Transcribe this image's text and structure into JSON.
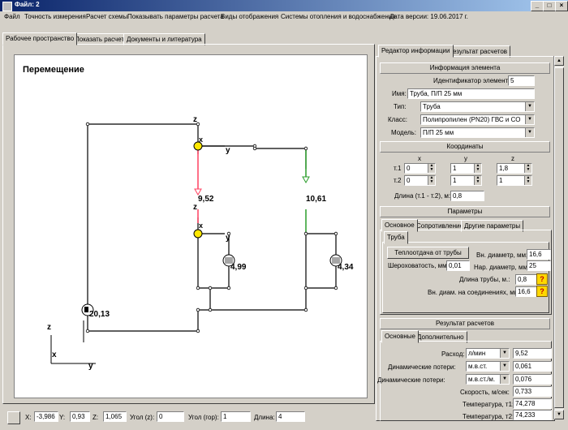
{
  "window": {
    "title": "Файл: 2"
  },
  "menu": [
    "Файл",
    "Точность измерения",
    "Расчет схемы",
    "Показывать параметры расчета",
    "Виды отображения",
    "Системы отопления и водоснабжения",
    "Дата версии: 19.06.2017 г."
  ],
  "main_tabs": [
    "Рабочее пространство",
    "Показать расчет",
    "Документы и литература"
  ],
  "canvas": {
    "title": "Перемещение",
    "axis_z": "z",
    "axis_x": "x",
    "axis_y": "y",
    "labels": {
      "l1": "9,52",
      "l2": "10,61",
      "l3": "4,99",
      "l4": "4,34",
      "l5": "20,13"
    }
  },
  "right_tabs": [
    "Редактор информации",
    "Результат расчетов"
  ],
  "info": {
    "header": "Информация элемента",
    "id_label": "Идентификатор элемента:",
    "id_value": "5",
    "name_label": "Имя:",
    "name_value": "Труба, П/П 25 мм",
    "type_label": "Тип:",
    "type_value": "Труба",
    "class_label": "Класс:",
    "class_value": "Полипропилен (PN20) ГВС и СО",
    "model_label": "Модель:",
    "model_value": "П/П 25 мм"
  },
  "coords": {
    "header": "Координаты",
    "col_x": "x",
    "col_y": "y",
    "col_z": "z",
    "t1_label": "т.1",
    "t1": [
      "0",
      "1",
      "1,8"
    ],
    "t2_label": "т.2",
    "t2": [
      "0",
      "1",
      "1"
    ],
    "length_label": "Длина (т.1 - т.2), м:",
    "length_value": "0,8"
  },
  "params": {
    "header": "Параметры",
    "tabs": [
      "Основное",
      "Сопротивление",
      "Другие параметры"
    ],
    "subtab": "Труба",
    "heat_button": "Теплоотдача от трубы",
    "inner_d_label": "Вн. диаметр, мм:",
    "inner_d": "16,6",
    "rough_label": "Шероховатость, мм:",
    "rough": "0,01",
    "outer_d_label": "Нар. диаметр, мм:",
    "outer_d": "25",
    "pipe_len_label": "Длина трубы, м.:",
    "pipe_len": "0,8",
    "joint_d_label": "Вн. диам. на соединениях, мм:",
    "joint_d": "16,6",
    "help": "?"
  },
  "results": {
    "header": "Результат расчетов",
    "tabs": [
      "Основные",
      "Дополнительно"
    ],
    "flow_label": "Расход:",
    "flow_unit": "л/мин",
    "flow": "9,52",
    "dyn1_label": "Динамические потери:",
    "dyn1_unit": "м.в.ст.",
    "dyn1": "0,061",
    "dyn2_label": "Динамические потери:",
    "dyn2_unit": "м.в.ст./м.",
    "dyn2": "0,076",
    "speed_label": "Скорость, м/сек:",
    "speed": "0,733",
    "t1_label": "Температура, т1:",
    "t1": "74,278",
    "t2_label": "Температура, т2:",
    "t2": "74,233"
  },
  "statusbar": {
    "x_label": "X:",
    "x": "-3,986",
    "y_label": "Y:",
    "y": "0,93",
    "z_label": "Z:",
    "z": "1,065",
    "angle_z_label": "Угол (z):",
    "angle_z": "0",
    "angle_h_label": "Угол (гор):",
    "angle_h": "1",
    "length_label": "Длина:",
    "length": "4"
  }
}
